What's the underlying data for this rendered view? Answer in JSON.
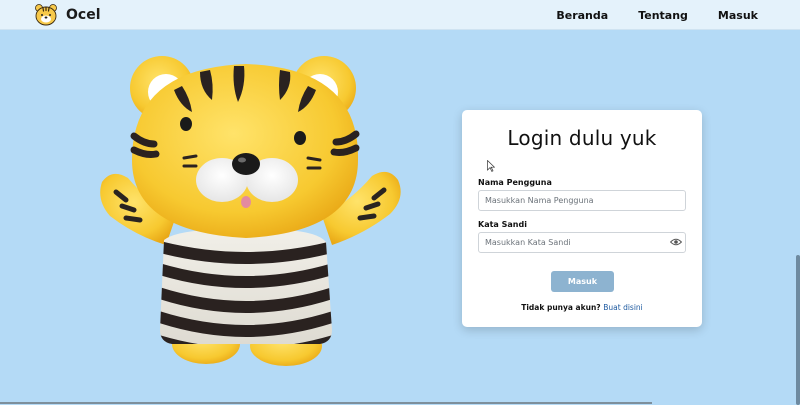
{
  "navbar": {
    "brand_name": "Ocel",
    "logo_icon": "tiger-face-icon",
    "links": [
      "Beranda",
      "Tentang",
      "Masuk"
    ]
  },
  "mascot": {
    "icon": "tiger-mascot-illustration"
  },
  "login": {
    "title": "Login dulu yuk",
    "username_label": "Nama Pengguna",
    "username_placeholder": "Masukkan Nama Pengguna",
    "username_value": "",
    "password_label": "Kata Sandi",
    "password_placeholder": "Masukkan Kata Sandi",
    "password_value": "",
    "submit_label": "Masuk",
    "signup_prompt": "Tidak punya akun?",
    "signup_link": "Buat disini"
  },
  "colors": {
    "page_bg": "#b4daf6",
    "navbar_bg": "#e4f2fb",
    "button_bg": "#8db3d0",
    "link": "#1e5aa0"
  }
}
